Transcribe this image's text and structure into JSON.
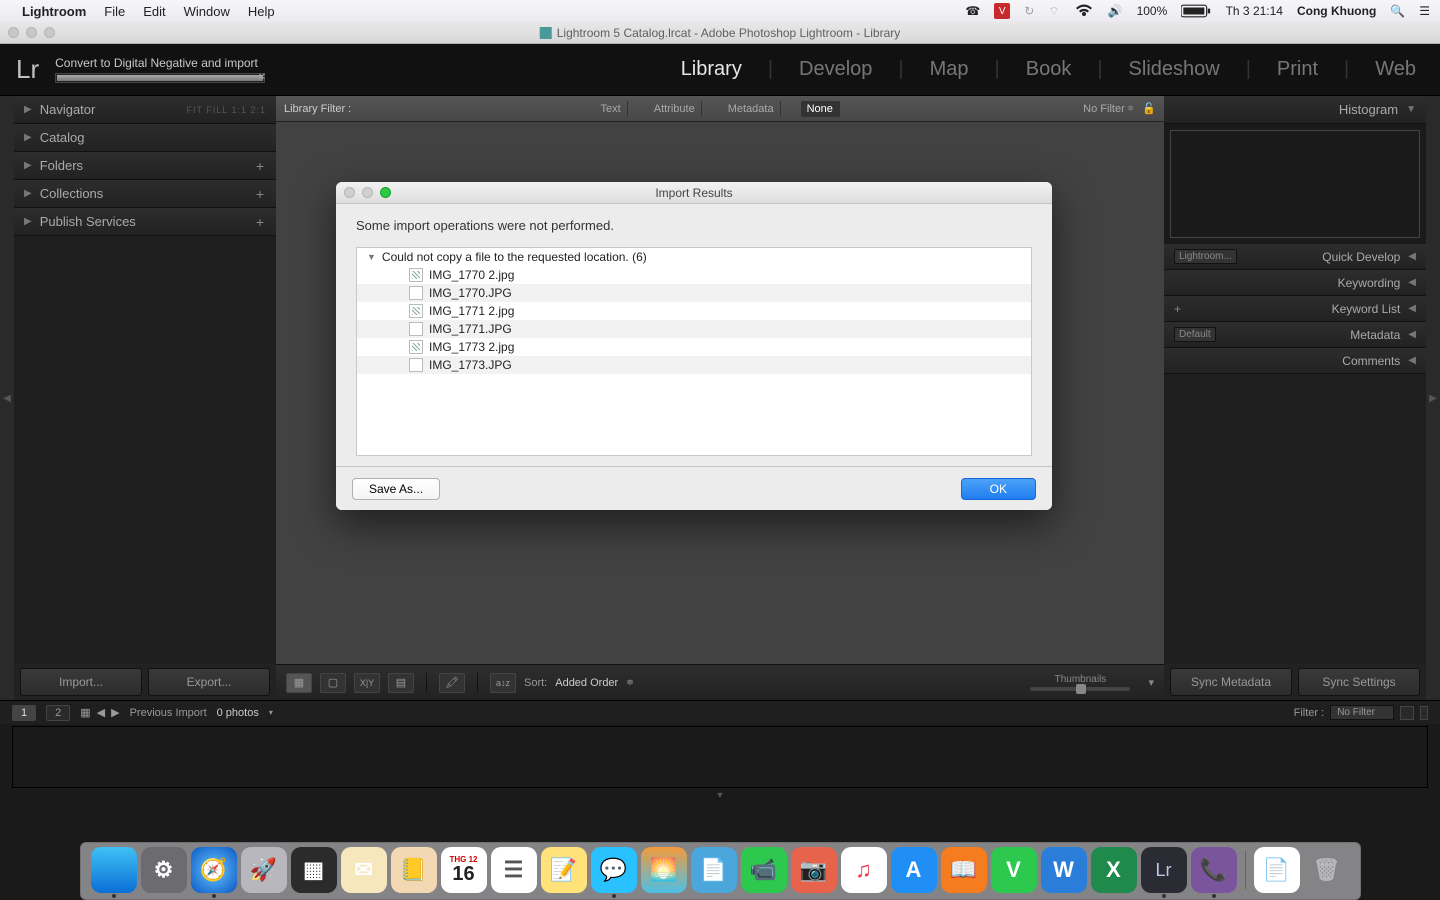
{
  "menubar": {
    "app": "Lightroom",
    "items": [
      "File",
      "Edit",
      "Window",
      "Help"
    ],
    "battery": "100%",
    "clock": "Th 3 21:14",
    "user": "Cong Khuong"
  },
  "window_title": "Lightroom 5 Catalog.lrcat - Adobe Photoshop Lightroom - Library",
  "progress_label": "Convert to Digital Negative and import",
  "modules": [
    "Library",
    "Develop",
    "Map",
    "Book",
    "Slideshow",
    "Print",
    "Web"
  ],
  "active_module": "Library",
  "left_panels": {
    "navigator": {
      "label": "Navigator",
      "tags": "FIT  FILL  1:1  2:1"
    },
    "items": [
      {
        "label": "Catalog",
        "plus": false
      },
      {
        "label": "Folders",
        "plus": true
      },
      {
        "label": "Collections",
        "plus": true
      },
      {
        "label": "Publish Services",
        "plus": true
      }
    ],
    "import": "Import...",
    "export": "Export..."
  },
  "filter_bar": {
    "label": "Library Filter :",
    "tabs": [
      "Text",
      "Attribute",
      "Metadata",
      "None"
    ],
    "active": "None",
    "no_filter": "No Filter"
  },
  "toolbar": {
    "sort_label": "Sort:",
    "sort_value": "Added Order",
    "thumb_label": "Thumbnails"
  },
  "right_panels": {
    "histogram": "Histogram",
    "rows": [
      {
        "label": "Quick Develop",
        "select": "Lightroom..."
      },
      {
        "label": "Keywording"
      },
      {
        "label": "Keyword List",
        "plus": true
      },
      {
        "label": "Metadata",
        "select": "Default"
      },
      {
        "label": "Comments"
      }
    ],
    "sync_meta": "Sync Metadata",
    "sync_set": "Sync Settings"
  },
  "filmstrip": {
    "badges": [
      "1",
      "2"
    ],
    "source": "Previous Import",
    "count": "0 photos",
    "filter_label": "Filter :",
    "filter_value": "No Filter"
  },
  "dialog": {
    "title": "Import Results",
    "message": "Some import operations were not performed.",
    "group": "Could not copy a file to the requested location. (6)",
    "files": [
      {
        "name": "IMG_1770 2.jpg",
        "dng": true
      },
      {
        "name": "IMG_1770.JPG",
        "dng": false
      },
      {
        "name": "IMG_1771 2.jpg",
        "dng": true
      },
      {
        "name": "IMG_1771.JPG",
        "dng": false
      },
      {
        "name": "IMG_1773 2.jpg",
        "dng": true
      },
      {
        "name": "IMG_1773.JPG",
        "dng": false
      }
    ],
    "save": "Save As...",
    "ok": "OK"
  },
  "dock": [
    {
      "name": "finder",
      "bg": "linear-gradient(#3fc1f5,#0b6fd6)",
      "txt": "",
      "dot": true
    },
    {
      "name": "settings",
      "bg": "#6c6c70",
      "txt": "⚙"
    },
    {
      "name": "safari",
      "bg": "radial-gradient(#68c6ff,#0a57c4)",
      "txt": "🧭",
      "dot": true
    },
    {
      "name": "launchpad",
      "bg": "#b7b7bd",
      "txt": "🚀"
    },
    {
      "name": "mission",
      "bg": "#2b2b2b",
      "txt": "▦"
    },
    {
      "name": "mail",
      "bg": "#f7e7bd",
      "txt": "✉"
    },
    {
      "name": "contacts",
      "bg": "#f3d8b3",
      "txt": "📒"
    },
    {
      "name": "calendar",
      "bg": "#fff",
      "txt": "16",
      "color": "#c00",
      "dot": false
    },
    {
      "name": "reminders",
      "bg": "#fff",
      "txt": "☰",
      "color": "#555"
    },
    {
      "name": "notes",
      "bg": "#ffe27a",
      "txt": "📝"
    },
    {
      "name": "messages",
      "bg": "#29c1ff",
      "txt": "💬",
      "dot": true
    },
    {
      "name": "photos",
      "bg": "linear-gradient(#f39b3b,#4cbfe6)",
      "txt": "🌅"
    },
    {
      "name": "preview",
      "bg": "#4aa6db",
      "txt": "📄"
    },
    {
      "name": "facetime",
      "bg": "#2cc94e",
      "txt": "📹"
    },
    {
      "name": "photobooth",
      "bg": "#e8634b",
      "txt": "📷"
    },
    {
      "name": "itunes",
      "bg": "#fff",
      "txt": "♫",
      "color": "#e8364b"
    },
    {
      "name": "appstore",
      "bg": "#1f8ff5",
      "txt": "A"
    },
    {
      "name": "ibooks",
      "bg": "#f57c1f",
      "txt": "📖"
    },
    {
      "name": "vapp",
      "bg": "#2cc94e",
      "txt": "V"
    },
    {
      "name": "word",
      "bg": "#2a7dd8",
      "txt": "W"
    },
    {
      "name": "excel",
      "bg": "#1f8a4c",
      "txt": "X"
    },
    {
      "name": "lightroom",
      "bg": "#2b2b33",
      "txt": "Lr",
      "color": "#b9c7e6",
      "dot": true
    },
    {
      "name": "viber",
      "bg": "#7b549e",
      "txt": "📞",
      "dot": true
    },
    {
      "name": "textedit",
      "bg": "#fff",
      "txt": "📄"
    },
    {
      "name": "trash",
      "bg": "transparent",
      "txt": "🗑",
      "color": "#b8b8bc"
    }
  ]
}
